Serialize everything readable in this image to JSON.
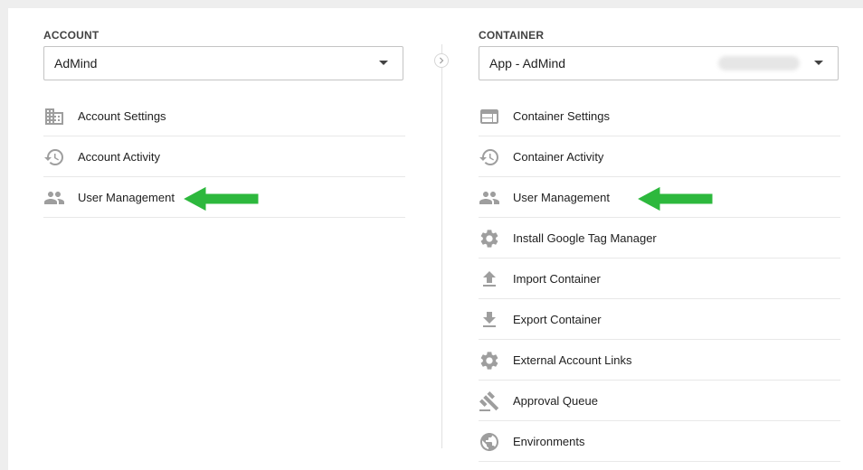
{
  "account": {
    "label": "ACCOUNT",
    "selected": "AdMind",
    "items": [
      {
        "label": "Account Settings",
        "icon": "building-icon"
      },
      {
        "label": "Account Activity",
        "icon": "history-icon"
      },
      {
        "label": "User Management",
        "icon": "people-icon"
      }
    ]
  },
  "container": {
    "label": "CONTAINER",
    "selected": "App - AdMind",
    "items": [
      {
        "label": "Container Settings",
        "icon": "web-window-icon"
      },
      {
        "label": "Container Activity",
        "icon": "history-icon"
      },
      {
        "label": "User Management",
        "icon": "people-icon"
      },
      {
        "label": "Install Google Tag Manager",
        "icon": "gear-icon"
      },
      {
        "label": "Import Container",
        "icon": "upload-icon"
      },
      {
        "label": "Export Container",
        "icon": "download-icon"
      },
      {
        "label": "External Account Links",
        "icon": "gear-icon"
      },
      {
        "label": "Approval Queue",
        "icon": "gavel-icon"
      },
      {
        "label": "Environments",
        "icon": "globe-icon"
      }
    ]
  },
  "colors": {
    "icon": "#9e9e9e",
    "arrow": "#2db83d",
    "divider": "#e8e8e8"
  }
}
